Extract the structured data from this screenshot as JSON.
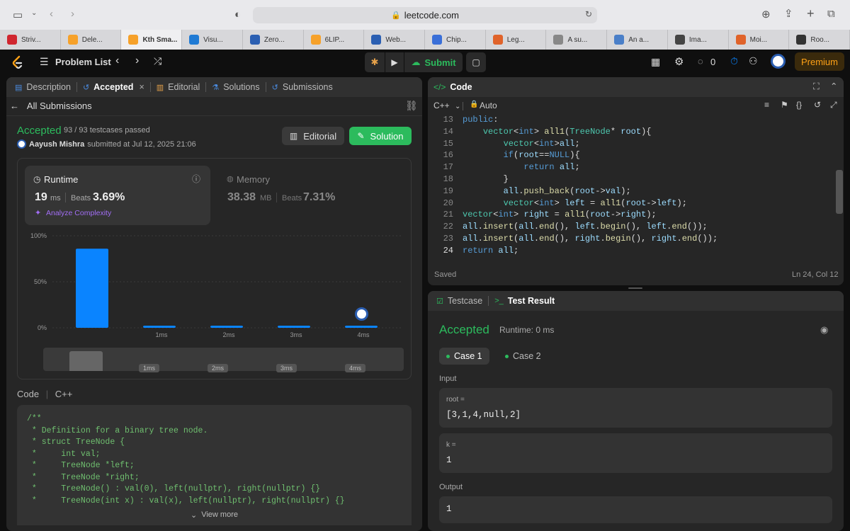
{
  "browser": {
    "url": "leetcode.com",
    "tabs": [
      {
        "label": "Striv...",
        "color": "#d0262f"
      },
      {
        "label": "Dele...",
        "color": "#f6a12a"
      },
      {
        "label": "Kth Sma...",
        "color": "#f6a12a"
      },
      {
        "label": "Visu...",
        "color": "#1f7ad4"
      },
      {
        "label": "Zero...",
        "color": "#2b5fb2"
      },
      {
        "label": "6LIP...",
        "color": "#f6a12a"
      },
      {
        "label": "Web...",
        "color": "#2b5fb2"
      },
      {
        "label": "Chip...",
        "color": "#3a6fd8"
      },
      {
        "label": "Leg...",
        "color": "#e0632a"
      },
      {
        "label": "A su...",
        "color": "#888888"
      },
      {
        "label": "An a...",
        "color": "#4a7fc8"
      },
      {
        "label": "Ima...",
        "color": "#444444"
      },
      {
        "label": "Moi...",
        "color": "#e0632a"
      },
      {
        "label": "Roo...",
        "color": "#333333"
      }
    ],
    "active_tab_index": 2
  },
  "nav": {
    "problem_list": "Problem List",
    "submit": "Submit",
    "streak_count": "0",
    "premium": "Premium"
  },
  "left_panel": {
    "tabs": [
      "Description",
      "Accepted",
      "Editorial",
      "Solutions",
      "Submissions"
    ],
    "all_submissions": "All Submissions",
    "status": "Accepted",
    "testcases": "93 / 93 testcases passed",
    "user": "Aayush Mishra",
    "submitted_at": "submitted at Jul 12, 2025 21:06",
    "editorial_btn": "Editorial",
    "solution_btn": "Solution",
    "runtime": {
      "title": "Runtime",
      "value": "19",
      "unit": "ms",
      "beats_label": "Beats",
      "beats": "3.69%",
      "analyze": "Analyze Complexity"
    },
    "memory": {
      "title": "Memory",
      "value": "38.38",
      "unit": "MB",
      "beats_label": "Beats",
      "beats": "7.31%"
    },
    "code_label": "Code",
    "code_lang": "C++",
    "code_lines": [
      "/**",
      " * Definition for a binary tree node.",
      " * struct TreeNode {",
      " *     int val;",
      " *     TreeNode *left;",
      " *     TreeNode *right;",
      " *     TreeNode() : val(0), left(nullptr), right(nullptr) {}",
      " *     TreeNode(int x) : val(x), left(nullptr), right(nullptr) {}"
    ],
    "view_more": "View more"
  },
  "chart_data": {
    "type": "bar",
    "categories": [
      "",
      "1ms",
      "2ms",
      "3ms",
      "4ms"
    ],
    "values": [
      86,
      2,
      2,
      2,
      2
    ],
    "y_ticks": [
      "100%",
      "50%",
      "0%"
    ],
    "ylim": [
      0,
      100
    ],
    "grid": true
  },
  "editor": {
    "title": "Code",
    "language": "C++",
    "mode": "Auto",
    "saved": "Saved",
    "cursor": "Ln 24, Col 12",
    "lines": [
      {
        "n": "13",
        "text": "public:"
      },
      {
        "n": "14",
        "text": "    vector<int> all1(TreeNode* root){"
      },
      {
        "n": "15",
        "text": "        vector<int>all;"
      },
      {
        "n": "16",
        "text": "        if(root==NULL){"
      },
      {
        "n": "17",
        "text": "            return all;"
      },
      {
        "n": "18",
        "text": "        }"
      },
      {
        "n": "19",
        "text": "        all.push_back(root->val);"
      },
      {
        "n": "20",
        "text": "        vector<int> left = all1(root->left);"
      },
      {
        "n": "21",
        "text": "vector<int> right = all1(root->right);"
      },
      {
        "n": "22",
        "text": "all.insert(all.end(), left.begin(), left.end());"
      },
      {
        "n": "23",
        "text": "all.insert(all.end(), right.begin(), right.end());"
      },
      {
        "n": "24",
        "text": "return all;"
      }
    ]
  },
  "result": {
    "tabs": [
      "Testcase",
      "Test Result"
    ],
    "status": "Accepted",
    "runtime": "Runtime: 0 ms",
    "cases": [
      "Case 1",
      "Case 2"
    ],
    "input_label": "Input",
    "inputs": [
      {
        "name": "root =",
        "value": "[3,1,4,null,2]"
      },
      {
        "name": "k =",
        "value": "1"
      }
    ],
    "output_label": "Output",
    "output": "1"
  }
}
